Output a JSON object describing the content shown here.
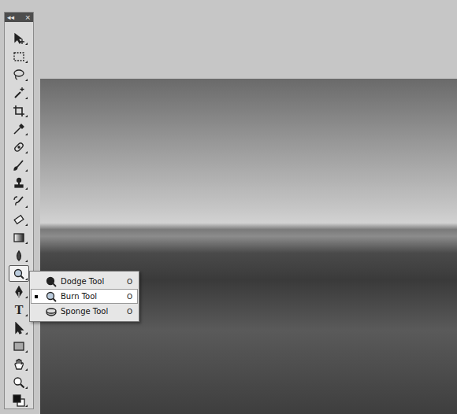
{
  "toolbar": {
    "collapse": "◂◂",
    "close": "×",
    "tools": [
      {
        "kind": "move",
        "selected": false
      },
      {
        "kind": "marquee",
        "selected": false
      },
      {
        "kind": "lasso",
        "selected": false
      },
      {
        "kind": "wand",
        "selected": false
      },
      {
        "kind": "crop",
        "selected": false
      },
      {
        "kind": "eyedropper",
        "selected": false
      },
      {
        "kind": "healing",
        "selected": false
      },
      {
        "kind": "brush",
        "selected": false
      },
      {
        "kind": "stamp",
        "selected": false
      },
      {
        "kind": "history",
        "selected": false
      },
      {
        "kind": "eraser",
        "selected": false
      },
      {
        "kind": "gradient",
        "selected": false
      },
      {
        "kind": "blur",
        "selected": false
      },
      {
        "kind": "burn",
        "selected": true
      },
      {
        "kind": "pen",
        "selected": false
      },
      {
        "kind": "type",
        "glyph": "T",
        "selected": false
      },
      {
        "kind": "path-select",
        "selected": false
      },
      {
        "kind": "shape",
        "selected": false
      },
      {
        "kind": "hand",
        "selected": false
      },
      {
        "kind": "zoom",
        "selected": false
      },
      {
        "kind": "colors",
        "selected": false
      }
    ]
  },
  "flyout": {
    "items": [
      {
        "label": "Dodge Tool",
        "shortcut": "O",
        "kind": "dodge",
        "selected": false
      },
      {
        "label": "Burn Tool",
        "shortcut": "O",
        "kind": "burn",
        "selected": true
      },
      {
        "label": "Sponge Tool",
        "shortcut": "O",
        "kind": "sponge",
        "selected": false
      }
    ]
  }
}
